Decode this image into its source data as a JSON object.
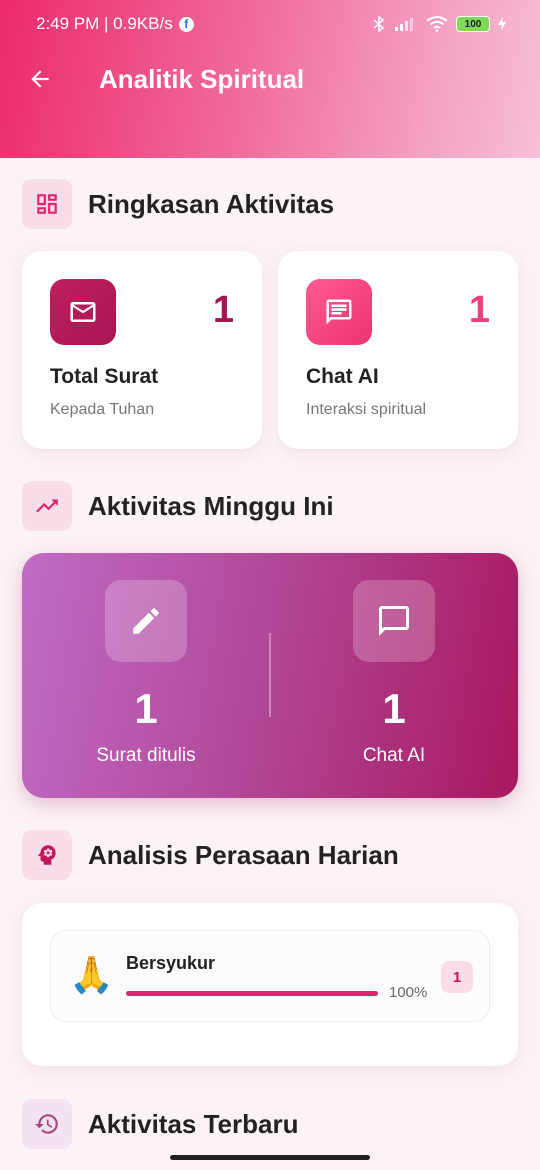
{
  "status_bar": {
    "time_speed": "2:49 PM | 0.9KB/s",
    "fb_icon": "facebook-icon",
    "battery": "100"
  },
  "app_bar": {
    "title": "Analitik Spiritual",
    "back_icon": "arrow-back-icon"
  },
  "summary": {
    "title": "Ringkasan Aktivitas",
    "icon": "dashboard-icon",
    "cards": [
      {
        "label": "Total Surat",
        "sub": "Kepada Tuhan",
        "value": "1",
        "icon": "mail-icon",
        "color": "#b01857"
      },
      {
        "label": "Chat AI",
        "sub": "Interaksi spiritual",
        "value": "1",
        "icon": "chat-icon",
        "color": "#f0407e"
      }
    ]
  },
  "weekly": {
    "title": "Aktivitas Minggu Ini",
    "icon": "trending-up-icon",
    "items": [
      {
        "value": "1",
        "label": "Surat ditulis",
        "icon": "pencil-icon"
      },
      {
        "value": "1",
        "label": "Chat AI",
        "icon": "chat-bubble-icon"
      }
    ]
  },
  "mood": {
    "title": "Analisis Perasaan Harian",
    "icon": "psychology-icon",
    "entries": [
      {
        "emoji": "🙏",
        "name": "Bersyukur",
        "percent_text": "100%",
        "fraction": 1.0,
        "count": "1"
      }
    ]
  },
  "recent": {
    "title": "Aktivitas Terbaru",
    "icon": "history-icon"
  },
  "colors": {
    "accent": "#e2246a",
    "header_start": "#ec2a6c",
    "header_end": "#f7bfd6"
  }
}
